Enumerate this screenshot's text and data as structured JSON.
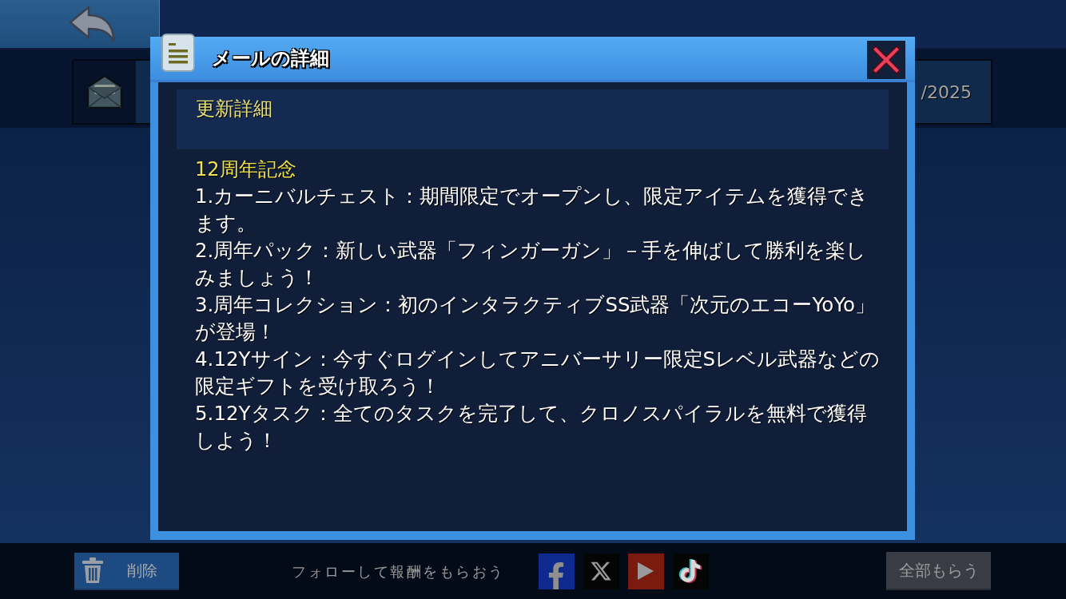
{
  "mail_list": [
    {
      "date": "/2025"
    }
  ],
  "dialog": {
    "title": "メールの詳細",
    "subject": "更新詳細",
    "heading": "12周年記念",
    "paragraphs": [
      "1.カーニバルチェスト：期間限定でオープンし、限定アイテムを獲得できます。",
      "2.周年パック：新しい武器「フィンガーガン」－手を伸ばして勝利を楽しみましょう！",
      "3.周年コレクション：初のインタラクティブSS武器「次元のエコーYoYo」が登場！",
      "4.12Yサイン：今すぐログインしてアニバーサリー限定Sレベル武器などの限定ギフトを受け取ろう！",
      "5.12Yタスク：全てのタスクを完了して、クロノスパイラルを無料で獲得しよう！"
    ]
  },
  "footer": {
    "delete_button": "削除",
    "follow_prompt": "フォローして報酬をもらおう",
    "claim_all_button": "全部もらう"
  }
}
